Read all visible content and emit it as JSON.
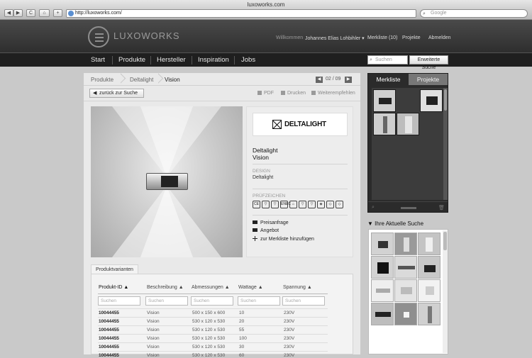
{
  "browser": {
    "window_title": "luxoworks.com",
    "back": "◀",
    "forward": "▶",
    "reload": "C",
    "home": "⌂",
    "add": "+",
    "url": "http://luxoworks.com/",
    "search_placeholder": "Google"
  },
  "header": {
    "logo_text": "LUXOWORKS",
    "welcome": "Willkommen",
    "user": "Johannes Elias Lohbihler ▾",
    "merkliste": "Merkliste (10)",
    "projekte": "Projekte",
    "logout": "Abmelden"
  },
  "mainnav": {
    "items": [
      "Start",
      "Produkte",
      "Hersteller",
      "Inspiration",
      "Jobs"
    ],
    "search_placeholder": "Suchen",
    "advanced_search": "Erweiterte Suche"
  },
  "breadcrumb": {
    "items": [
      "Produkte",
      "Deltalight",
      "Vision"
    ],
    "prev": "◀",
    "next": "▶",
    "page": "02 / 09"
  },
  "toolbar": {
    "back_label": "zurück zur Suche",
    "pdf": "PDF",
    "print": "Drucken",
    "recommend": "Weiterempfehlen"
  },
  "product": {
    "brand_logo": "DELTALIGHT",
    "manufacturer": "Deltalight",
    "name": "Vision",
    "design_label": "DESIGN",
    "design_value": "Deltalight",
    "certs_label": "PRÜFZEICHEN",
    "certs": [
      "CE",
      "▽",
      "▽",
      "ENEC",
      "⌂",
      "▽",
      "▽",
      "◈",
      "◇",
      "◇"
    ],
    "actions": [
      "Preisanfrage",
      "Angebot",
      "zur Merkliste hinzufügen"
    ]
  },
  "variants": {
    "tab": "Produktvarianten",
    "columns": [
      "Produkt-ID",
      "Beschreibung",
      "Abmessungen",
      "Wattage",
      "Spannung"
    ],
    "filter_placeholder": "Suchen",
    "rows": [
      [
        "10044455",
        "Vision",
        "500 x 150 x 600",
        "10",
        "230V"
      ],
      [
        "10044455",
        "Vision",
        "530 x 120 x 530",
        "20",
        "230V"
      ],
      [
        "10044455",
        "Vision",
        "530 x 120 x 530",
        "55",
        "230V"
      ],
      [
        "10044455",
        "Vision",
        "530 x 120 x 530",
        "100",
        "230V"
      ],
      [
        "10044455",
        "Vision",
        "530 x 120 x 530",
        "30",
        "230V"
      ],
      [
        "10044455",
        "Vision",
        "530 x 120 x 530",
        "60",
        "230V"
      ]
    ]
  },
  "merkliste": {
    "tab_active": "Merkliste",
    "tab_inactive": "Projekte",
    "search_icon": "⌕",
    "trash_icon": "🗑"
  },
  "aktuelle_suche": {
    "title": "▼ Ihre Aktuelle Suche"
  },
  "colors": {
    "header_bg": "#3a3a3a",
    "nav_bg": "#1f1f1f",
    "panel_bg": "#e9e9e9"
  }
}
